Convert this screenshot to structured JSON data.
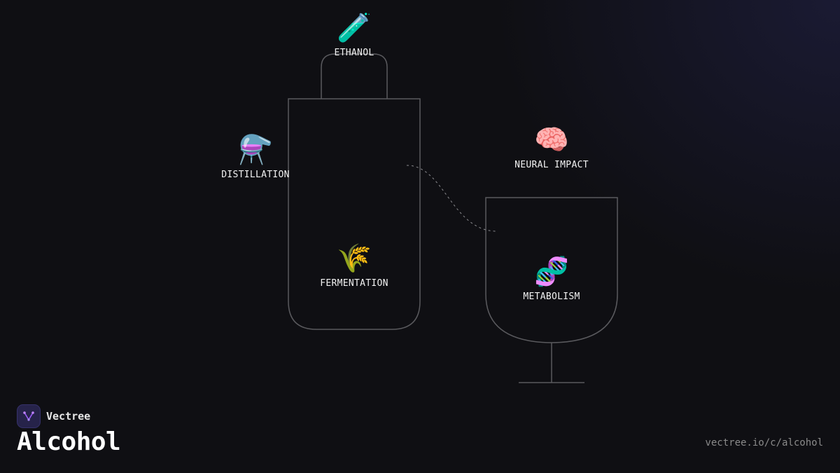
{
  "brand": {
    "name": "Vectree",
    "logo_icon": "vectree-logo-icon"
  },
  "page": {
    "title": "Alcohol",
    "url": "vectree.io/c/alcohol"
  },
  "colors": {
    "background": "#0f0f13",
    "outline": "#5a5a5e",
    "label": "#f2f2f2",
    "accent": "#9b5cf6"
  },
  "nodes": {
    "ethanol": {
      "label": "ETHANOL",
      "icon": "🧪",
      "icon_name": "test-tube-icon"
    },
    "distillation": {
      "label": "DISTILLATION",
      "icon": "⚗️",
      "icon_name": "alembic-icon"
    },
    "fermentation": {
      "label": "FERMENTATION",
      "icon": "🌾",
      "icon_name": "wheat-icon"
    },
    "neural_impact": {
      "label": "NEURAL IMPACT",
      "icon": "🧠",
      "icon_name": "brain-icon"
    },
    "metabolism": {
      "label": "METABOLISM",
      "icon": "🧬",
      "icon_name": "dna-icon"
    }
  }
}
